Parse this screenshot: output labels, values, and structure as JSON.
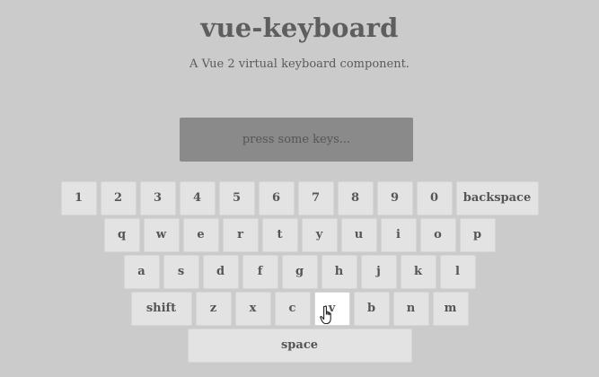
{
  "header": {
    "title": "vue-keyboard",
    "subtitle": "A Vue 2 virtual keyboard component."
  },
  "display": {
    "placeholder": "press some keys..."
  },
  "keyboard": {
    "rows": [
      [
        "1",
        "2",
        "3",
        "4",
        "5",
        "6",
        "7",
        "8",
        "9",
        "0",
        "backspace"
      ],
      [
        "q",
        "w",
        "e",
        "r",
        "t",
        "y",
        "u",
        "i",
        "o",
        "p"
      ],
      [
        "a",
        "s",
        "d",
        "f",
        "g",
        "h",
        "j",
        "k",
        "l"
      ],
      [
        "shift",
        "z",
        "x",
        "c",
        "v",
        "b",
        "n",
        "m"
      ],
      [
        "space"
      ]
    ],
    "hovered_key": "v"
  },
  "colors": {
    "background": "#cbcbcb",
    "display": "#8a8a8a",
    "key": "#e3e3e3",
    "key_hover": "#ffffff",
    "text": "#555555"
  },
  "icons": {
    "cursor": "hand-pointer-icon"
  }
}
